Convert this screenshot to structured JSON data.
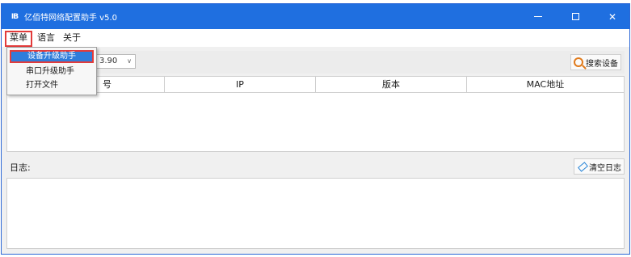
{
  "window": {
    "title": "亿佰特网络配置助手 v5.0",
    "icon_glyph": "IB",
    "controls": [
      "minimize",
      "maximize",
      "close"
    ]
  },
  "menubar": {
    "items": [
      {
        "label": "菜单"
      },
      {
        "label": "语言"
      },
      {
        "label": "关于"
      }
    ]
  },
  "dropdown": {
    "items": [
      {
        "label": "设备升级助手",
        "selected": true
      },
      {
        "label": "串口升级助手",
        "selected": false
      },
      {
        "label": "打开文件",
        "selected": false
      }
    ]
  },
  "toolbar": {
    "version_value": "3.90",
    "search_button_label": "搜索设备"
  },
  "device_table": {
    "columns": [
      "号",
      "IP",
      "版本",
      "MAC地址"
    ],
    "rows": []
  },
  "log": {
    "label": "日志:",
    "clear_button_label": "清空日志",
    "content": ""
  },
  "colors": {
    "titlebar": "#1f6fe0",
    "highlight_border": "#e23b3b",
    "selection": "#2f7ddb"
  }
}
